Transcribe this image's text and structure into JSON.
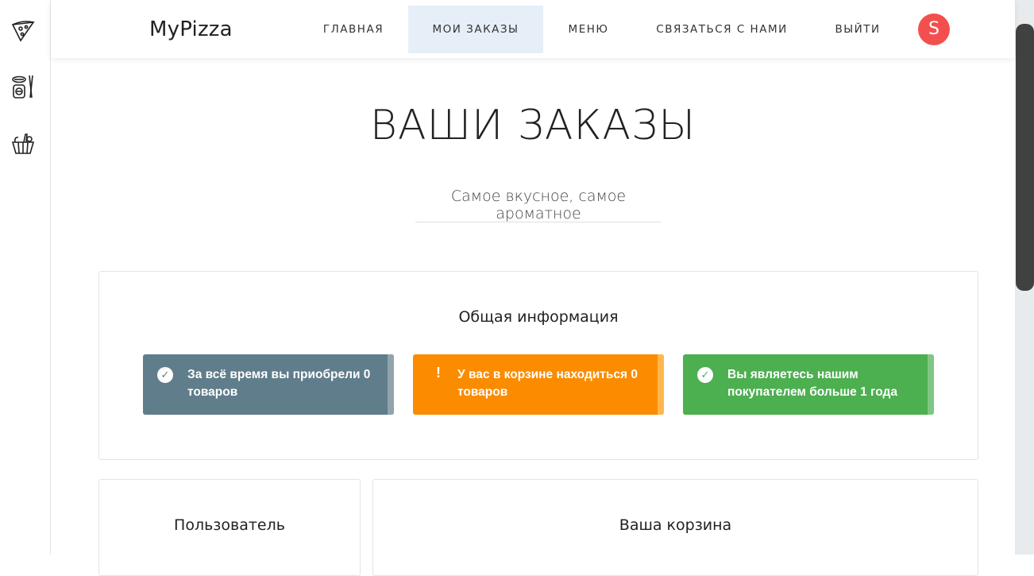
{
  "app": {
    "brand": "MyPizza",
    "avatar_letter": "S"
  },
  "sidebar": {
    "icons": [
      "pizza-slice-icon",
      "sushi-icon",
      "basket-icon"
    ]
  },
  "nav": {
    "items": [
      {
        "label": "ГЛАВНАЯ",
        "active": false
      },
      {
        "label": "МОИ ЗАКАЗЫ",
        "active": true
      },
      {
        "label": "МЕНЮ",
        "active": false
      },
      {
        "label": "СВЯЗАТЬСЯ С НАМИ",
        "active": false
      },
      {
        "label": "ВЫЙТИ",
        "active": false
      }
    ]
  },
  "hero": {
    "title": "ВАШИ ЗАКАЗЫ",
    "subtitle": "Самое вкусное, самое ароматное"
  },
  "info": {
    "title": "Общая информация",
    "alerts": [
      {
        "text": "За всё время вы приобрели 0 товаров",
        "icon": "check-icon",
        "color": "#607d8b",
        "edge": "#90a4ae"
      },
      {
        "text": "У вас в корзине находиться 0 товаров",
        "icon": "exclamation-icon",
        "color": "#fb8c00",
        "edge": "#ffb74d"
      },
      {
        "text": "Вы являетесь нашим покупателем больше 1 года",
        "icon": "check-icon",
        "color": "#4caf50",
        "edge": "#81c784"
      }
    ]
  },
  "user_card": {
    "title": "Пользователь"
  },
  "cart_card": {
    "title": "Ваша корзина"
  },
  "colors": {
    "accent": "#e6eff8",
    "avatar": "#f44f4f"
  }
}
